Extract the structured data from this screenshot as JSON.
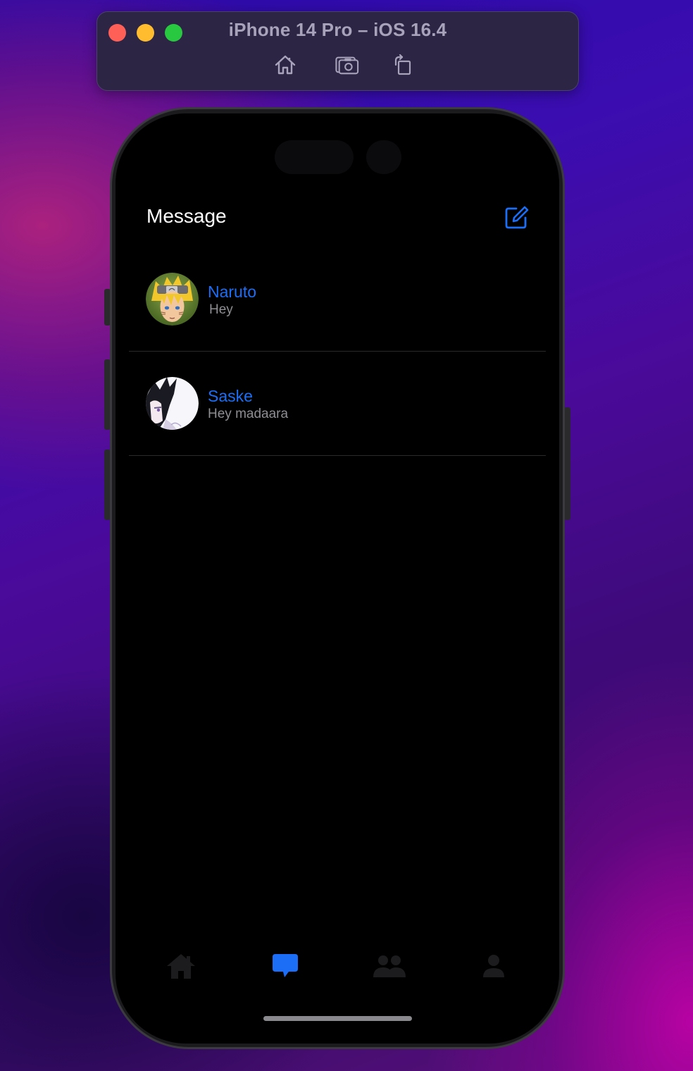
{
  "simulator": {
    "title": "iPhone 14 Pro – iOS 16.4",
    "toolbar": [
      "home-icon",
      "screenshot-icon",
      "rotate-icon"
    ]
  },
  "app": {
    "title": "Message",
    "compose_icon": "compose-icon",
    "accent_color": "#1b6ef5",
    "conversations": [
      {
        "name": "Naruto",
        "preview": "Hey",
        "avatar": "naruto-avatar"
      },
      {
        "name": "Saske",
        "preview": "Hey madaara",
        "avatar": "sasuke-avatar"
      }
    ],
    "tabs": [
      {
        "icon": "home-icon",
        "active": false
      },
      {
        "icon": "chat-bubble-icon",
        "active": true
      },
      {
        "icon": "people-icon",
        "active": false
      },
      {
        "icon": "person-icon",
        "active": false
      }
    ]
  }
}
